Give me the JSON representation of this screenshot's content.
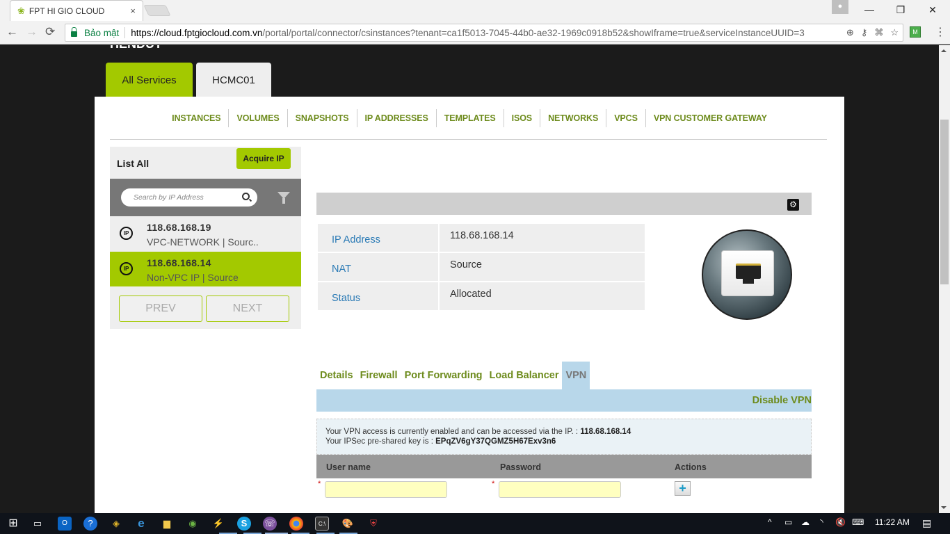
{
  "browser": {
    "tab_title": "FPT HI GIO CLOUD",
    "tab_close": "×",
    "secure_label": "Bảo mật",
    "url_host": "https://cloud.fptgiocloud.com.vn",
    "url_rest": "/portal/portal/connector/csinstances?tenant=ca1f5013-7045-44b0-ae32-1969c0918b52&showIframe=true&serviceInstanceUUID=3",
    "back": "←",
    "forward": "→",
    "reload": "⟳",
    "minimize": "—",
    "restore": "❐",
    "close": "✕",
    "zoom_icon": "⊕",
    "key_icon": "⚷",
    "translate_icon": "⌘",
    "star_icon": "☆",
    "menu": "⋮"
  },
  "page": {
    "clipped_heading": "TIENDUT",
    "top_tabs": [
      {
        "label": "All Services",
        "active": true
      },
      {
        "label": "HCMC01",
        "active": false
      }
    ],
    "subnav": [
      "INSTANCES",
      "VOLUMES",
      "SNAPSHOTS",
      "IP ADDRESSES",
      "TEMPLATES",
      "ISOS",
      "NETWORKS",
      "VPCS",
      "VPN CUSTOMER GATEWAY"
    ]
  },
  "left_panel": {
    "list_all": "List All",
    "acquire_ip": "Acquire IP",
    "search_placeholder": "Search by IP Address",
    "items": [
      {
        "badge": "IP",
        "ip": "118.68.168.19",
        "sub": "VPC-NETWORK | Sourc..",
        "selected": false
      },
      {
        "badge": "IP",
        "ip": "118.68.168.14",
        "sub": "Non-VPC IP | Source",
        "selected": true
      }
    ],
    "prev": "PREV",
    "next": "NEXT"
  },
  "detail": {
    "rows": [
      {
        "key": "IP Address",
        "value": "118.68.168.14"
      },
      {
        "key": "NAT",
        "value": "Source"
      },
      {
        "key": "Status",
        "value": "Allocated"
      }
    ],
    "tabs": [
      "Details",
      "Firewall",
      "Port Forwarding",
      "Load Balancer",
      "VPN"
    ],
    "active_tab": "VPN",
    "disable_vpn": "Disable VPN",
    "vpn_line1_prefix": "Your VPN access is currently enabled and can be accessed via the IP. : ",
    "vpn_ip": "118.68.168.14",
    "vpn_line2_prefix": "Your IPSec pre-shared key is : ",
    "vpn_key": "EPqZV6gY37QGMZ5H67Exv3n6",
    "users_table": {
      "headers": [
        "User name",
        "Password",
        "Actions"
      ],
      "username_value": "",
      "password_value": "",
      "required_mark": "*",
      "add_label": "+"
    }
  },
  "taskbar": {
    "time": "11:22 AM",
    "apps": [
      "start",
      "task-view",
      "outlook",
      "help",
      "vmware",
      "edge",
      "file-explorer",
      "greenshot",
      "network-tool",
      "skype",
      "viber",
      "chrome",
      "cmd",
      "paint",
      "shield-app"
    ]
  },
  "colors": {
    "accent_green": "#a3c900",
    "nav_green": "#6d8b1c",
    "link_blue": "#2a7ab5",
    "vpn_blue": "#b8d7ea"
  }
}
